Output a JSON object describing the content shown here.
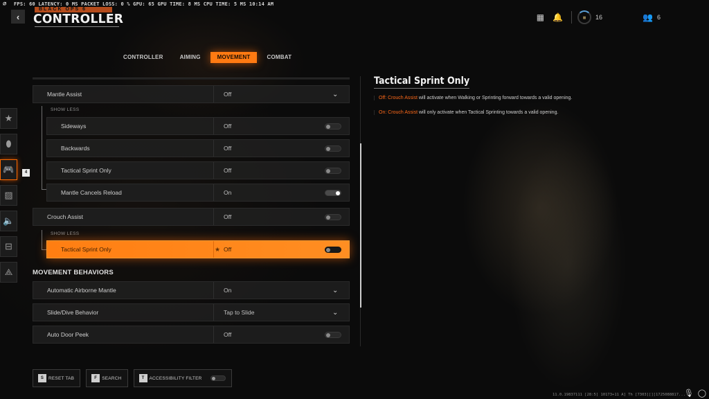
{
  "perf_bar": {
    "text": "FPS: 60  LATENCY: 0  MS  PACKET LOSS: 0 %  GPU: 65  GPU TIME: 8  MS  CPU TIME: 5  MS  10:14 AM"
  },
  "header": {
    "back_icon": "chevron-left-icon",
    "game_logo": "BLACK OPS 6",
    "title": "CONTROLLER"
  },
  "top_right": {
    "grid_icon": "grid-icon",
    "bell_icon": "bell-icon",
    "level": "16",
    "friends_count": "6"
  },
  "tabs": [
    {
      "label": "CONTROLLER",
      "active": false
    },
    {
      "label": "AIMING",
      "active": false
    },
    {
      "label": "MOVEMENT",
      "active": true
    },
    {
      "label": "COMBAT",
      "active": false
    }
  ],
  "side_rail": {
    "items": [
      {
        "icon": "star-icon",
        "glyph": "★"
      },
      {
        "icon": "mouse-icon",
        "glyph": "🖱"
      },
      {
        "icon": "gamepad-icon",
        "glyph": "🎮",
        "active": true
      },
      {
        "icon": "display-icon",
        "glyph": "▨"
      },
      {
        "icon": "speaker-icon",
        "glyph": "🔊"
      },
      {
        "icon": "interface-icon",
        "glyph": "⊟"
      },
      {
        "icon": "network-icon",
        "glyph": "⟁"
      }
    ],
    "badge": "4"
  },
  "settings": {
    "show_less": "SHOW LESS",
    "section_movement_behaviors": "MOVEMENT BEHAVIORS",
    "rows": [
      {
        "label": "Mantle Assist",
        "value": "Off",
        "control": "dropdown"
      },
      {
        "label": "Sideways",
        "value": "Off",
        "control": "toggle",
        "on": false
      },
      {
        "label": "Backwards",
        "value": "Off",
        "control": "toggle",
        "on": false
      },
      {
        "label": "Tactical Sprint Only",
        "value": "Off",
        "control": "toggle",
        "on": false
      },
      {
        "label": "Mantle Cancels Reload",
        "value": "On",
        "control": "toggle",
        "on": true
      },
      {
        "label": "Crouch Assist",
        "value": "Off",
        "control": "toggle",
        "on": false
      },
      {
        "label": "Tactical Sprint Only",
        "value": "Off",
        "control": "toggle",
        "on": false,
        "highlighted": true
      },
      {
        "label": "Automatic Airborne Mantle",
        "value": "On",
        "control": "dropdown"
      },
      {
        "label": "Slide/Dive Behavior",
        "value": "Tap to Slide",
        "control": "dropdown"
      },
      {
        "label": "Auto Door Peek",
        "value": "Off",
        "control": "toggle",
        "on": false
      }
    ]
  },
  "detail": {
    "title": "Tactical Sprint Only",
    "lines": [
      {
        "highlight": "Off: Crouch Assist",
        "text": " will activate when Walking or Sprinting forward towards a valid opening."
      },
      {
        "highlight": "On: Crouch Assist",
        "text": " will only activate when Tactical Sprinting towards a valid opening."
      }
    ]
  },
  "bottom_bar": {
    "reset": {
      "key": "S",
      "label": "RESET TAB"
    },
    "search": {
      "key": "F",
      "label": "SEARCH"
    },
    "accessibility": {
      "key": "T",
      "label": "ACCESSIBILITY FILTER",
      "on": false
    }
  },
  "build_info": "11.0.19837111 [28:5] 10173+11 A] Th [7303][][1725088817..."
}
